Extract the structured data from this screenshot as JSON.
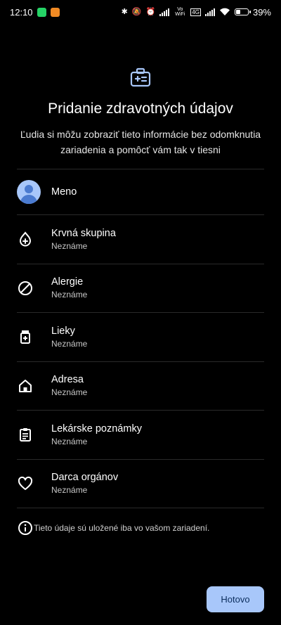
{
  "status_bar": {
    "time": "12:10",
    "network_label": "Vo WiFi",
    "network_label2": "4G",
    "battery_percent": "39%",
    "battery_level": 0.39
  },
  "header": {
    "icon": "medical-id-card-icon",
    "title": "Pridanie zdravotných údajov",
    "subtitle": "Ľudia si môžu zobraziť tieto informácie bez odomknutia zariadenia a pomôcť vám tak v tiesni"
  },
  "rows": [
    {
      "label": "Meno",
      "sub": "",
      "icon": "avatar-icon"
    },
    {
      "label": "Krvná skupina",
      "sub": "Neznáme",
      "icon": "blood-drop-icon"
    },
    {
      "label": "Alergie",
      "sub": "Neznáme",
      "icon": "block-icon"
    },
    {
      "label": "Lieky",
      "sub": "Neznáme",
      "icon": "medication-icon"
    },
    {
      "label": "Adresa",
      "sub": "Neznáme",
      "icon": "home-icon"
    },
    {
      "label": "Lekárske poznámky",
      "sub": "Neznáme",
      "icon": "clipboard-icon"
    },
    {
      "label": "Darca orgánov",
      "sub": "Neznáme",
      "icon": "heart-icon"
    }
  ],
  "info": {
    "icon": "info-icon",
    "text": "Tieto údaje sú uložené iba vo vašom zariadení."
  },
  "done_button": {
    "label": "Hotovo",
    "color": "#a8c7fa"
  },
  "colors": {
    "background": "#000000",
    "accent": "#a8c7fa",
    "header_icon": "#a8c7fa"
  }
}
